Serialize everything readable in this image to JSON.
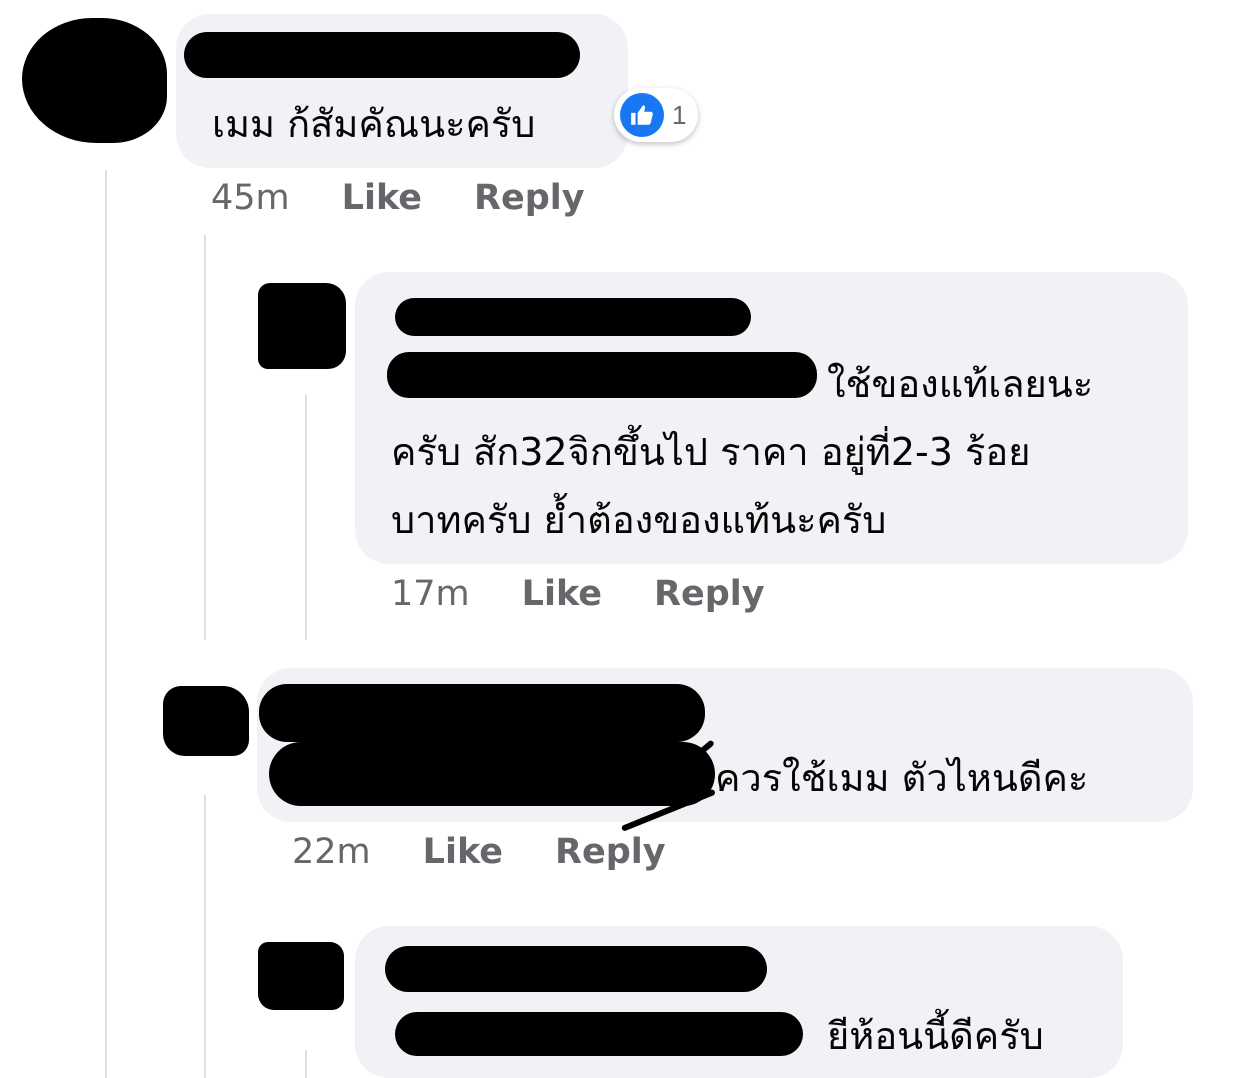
{
  "comments": [
    {
      "text": "เมม ก้สัมคัณนะครับ",
      "time": "45m",
      "like_label": "Like",
      "reply_label": "Reply",
      "reaction": {
        "icon": "thumbs-up-icon",
        "count": "1",
        "color": "#1877f2"
      }
    },
    {
      "text_lines": [
        "ใช้ของแท้เลยนะ",
        "ครับ สัก32จิกขึ้นไป ราคา อยู่ที่2-3 ร้อย",
        "บาทครับ ย้ำต้องของแท้นะครับ"
      ],
      "time": "17m",
      "like_label": "Like",
      "reply_label": "Reply"
    },
    {
      "text": "ควรใช้เมม ตัวไหนดีคะ",
      "time": "22m",
      "like_label": "Like",
      "reply_label": "Reply"
    },
    {
      "text": "ยีห้อนนี้ดีครับ"
    }
  ],
  "colors": {
    "bubble": "#f0f2f5",
    "meta_text": "#65676b",
    "thread_line": "#dddfe2",
    "accent": "#1877f2"
  }
}
